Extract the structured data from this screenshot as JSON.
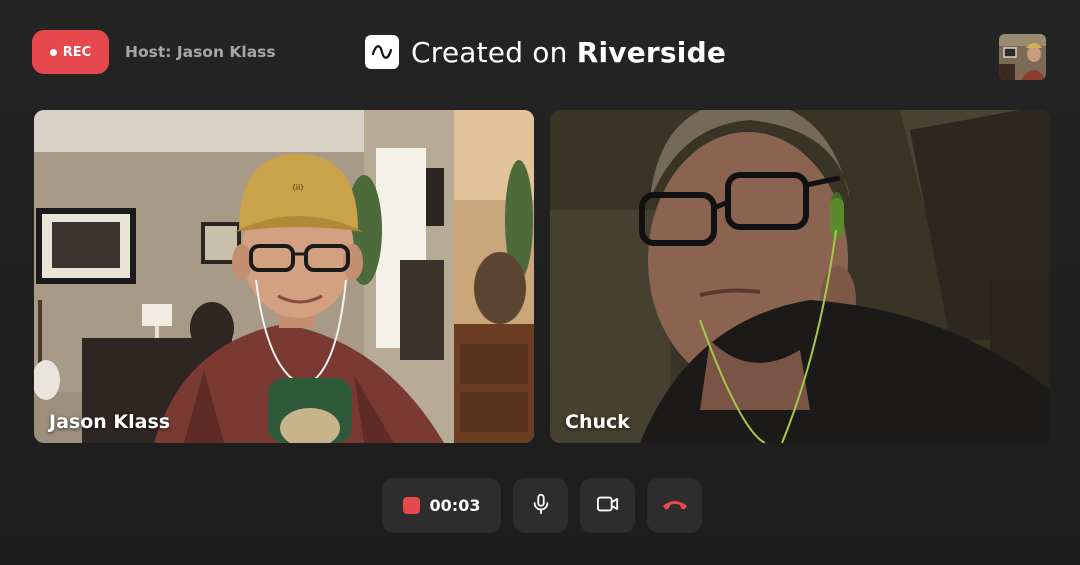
{
  "header": {
    "rec_label": "REC",
    "host_text": "Host: Jason Klass",
    "brand_prefix": "Created on",
    "brand_name": "Riverside"
  },
  "participants": [
    {
      "name": "Jason Klass"
    },
    {
      "name": "Chuck"
    }
  ],
  "controls": {
    "timer": "00:03"
  },
  "colors": {
    "accent_red": "#e5484d",
    "background": "#1f1f1f",
    "control_bg": "#2d2d2d",
    "muted_text": "#a6a6a6"
  },
  "icons": {
    "record": "record-dot-icon",
    "brand": "riverside-logo-icon",
    "timer": "stop-square-icon",
    "mic": "microphone-icon",
    "camera": "camera-icon",
    "hangup": "phone-hangup-icon"
  }
}
